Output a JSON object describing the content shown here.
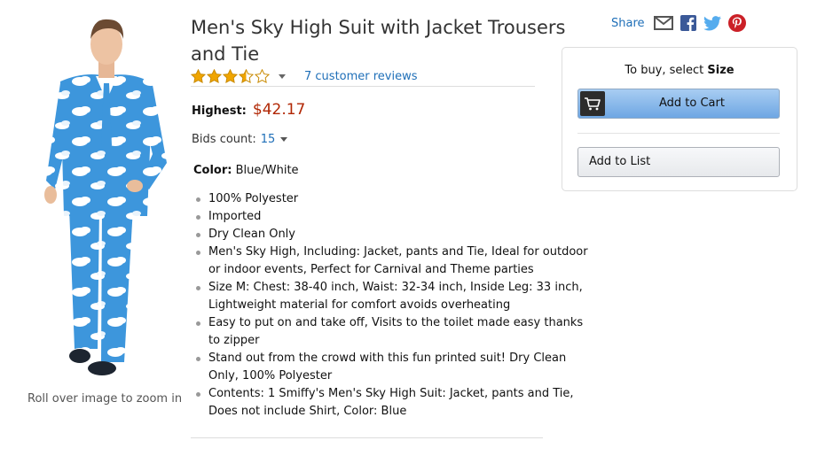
{
  "product": {
    "title": "Men's Sky High Suit with Jacket Trousers and Tie",
    "rating": 3.5,
    "rating_max": 5,
    "reviews_link": "7 customer reviews",
    "zoom_hint": "Roll over image to zoom in",
    "image_icon": "sky-suit-model-photo"
  },
  "price": {
    "label": "Highest:",
    "value": "$42.17"
  },
  "bids": {
    "label": "Bids count:",
    "value": "15"
  },
  "color": {
    "label": "Color:",
    "value": "Blue/White"
  },
  "features": [
    "100% Polyester",
    "Imported",
    "Dry Clean Only",
    "Men's Sky High, Including: Jacket, pants and Tie, Ideal for outdoor or indoor events, Perfect for Carnival and Theme parties",
    "Size M: Chest: 38-40 inch, Waist: 32-34 inch, Inside Leg: 33 inch, Lightweight material for comfort avoids overheating",
    "Easy to put on and take off, Visits to the toilet made easy thanks to zipper",
    "Stand out from the crowd with this fun printed suit! Dry Clean Only, 100% Polyester",
    "Contents: 1 Smiffy's Men's Sky High Suit: Jacket, pants and Tie, Does not include Shirt, Color: Blue"
  ],
  "share": {
    "label": "Share",
    "icons": [
      "email-icon",
      "facebook-icon",
      "twitter-icon",
      "pinterest-icon"
    ]
  },
  "buybox": {
    "prompt_prefix": "To buy, select",
    "prompt_emphasis": "Size",
    "add_to_cart": "Add to Cart",
    "add_to_list": "Add to List"
  },
  "colors": {
    "link": "#1f6fb8",
    "price": "#b12704",
    "star": "#f0a500",
    "facebook": "#3b5998",
    "twitter": "#55acee",
    "pinterest": "#cb2027"
  }
}
